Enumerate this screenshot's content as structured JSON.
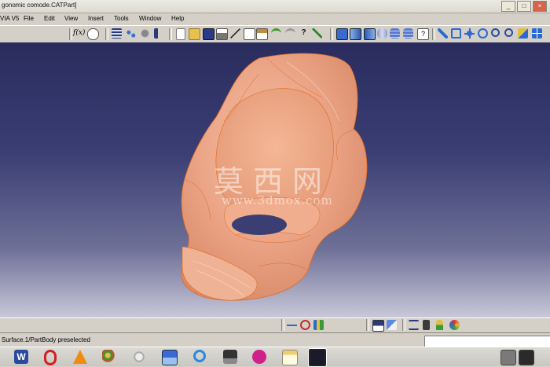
{
  "window": {
    "title": "gonomic comode.CATPart]",
    "minimize_glyph": "_",
    "maximize_glyph": "□",
    "close_glyph": "×"
  },
  "menu": [
    "VIA V5",
    "File",
    "Edit",
    "View",
    "Insert",
    "Tools",
    "Window",
    "Help"
  ],
  "toolbar": {
    "formula_label": "f(x)"
  },
  "icons": {
    "toolbar": [
      "formula-icon",
      "knowledge-icon",
      "table-icon",
      "tree-icon",
      "catalog-icon",
      "layout-icon",
      "new-icon",
      "open-icon",
      "save-icon",
      "print-icon",
      "cut-icon",
      "copy-icon",
      "paste-icon",
      "undo-icon",
      "redo-icon",
      "whats-this-icon",
      "sketch-icon",
      "cube-view-icon",
      "iso-view-icon",
      "front-view-icon",
      "cylinder-icon",
      "database-icon",
      "help-icon",
      "fly-mode-icon",
      "fit-all-icon",
      "pan-icon",
      "rotate-icon",
      "zoom-in-icon",
      "zoom-out-icon",
      "normal-view-icon",
      "multi-view-icon"
    ],
    "bottom_toolbar": [
      "measure-icon",
      "dimension-icon",
      "scan-icon",
      "tools-icon",
      "eraser-icon",
      "compass-icon",
      "bolt-icon",
      "light-icon",
      "render-icon"
    ],
    "taskbar": [
      "word-icon",
      "opera-icon",
      "vlc-icon",
      "paint-icon",
      "network-icon",
      "imageviewer-icon",
      "ie-icon",
      "monitor-icon",
      "qq-icon",
      "notes-icon",
      "catia-icon",
      "app-a-icon",
      "app-b-icon"
    ]
  },
  "viewport": {
    "background_top": "#2a2c5e",
    "background_bottom": "#c8c8d8",
    "model_color": "#eba486",
    "edge_color": "#e06a20",
    "watermark_cn": "莫西网",
    "watermark_url": "www.3dmox.com"
  },
  "status": {
    "message": "Surface.1/PartBody preselected",
    "command_value": ""
  }
}
